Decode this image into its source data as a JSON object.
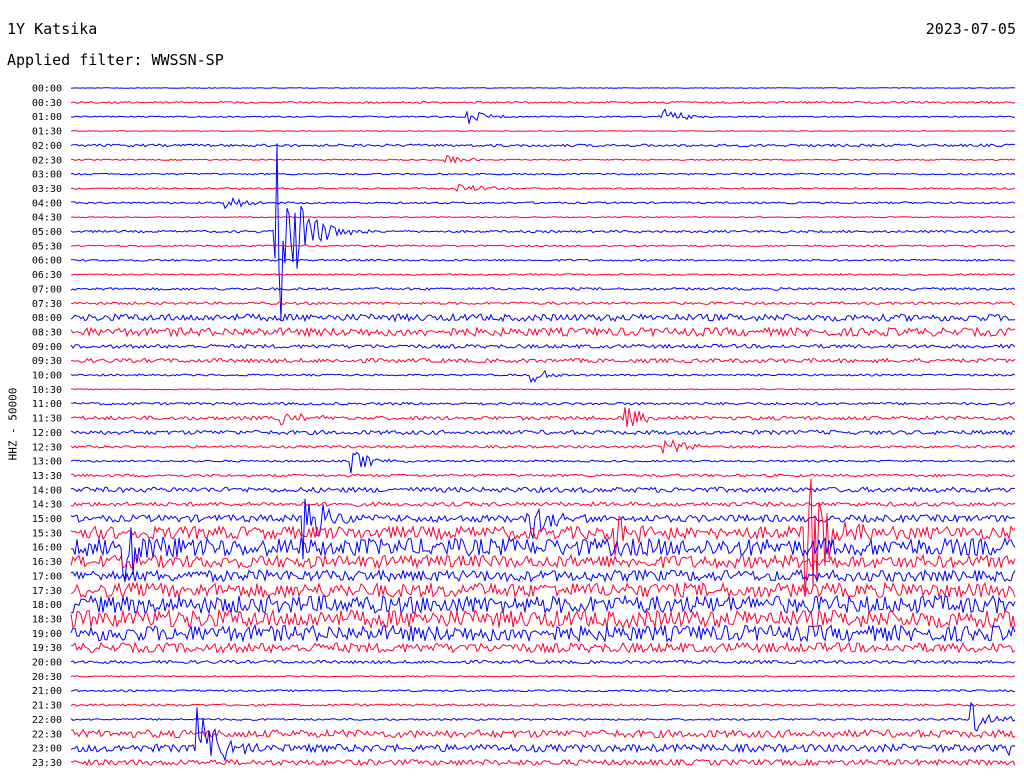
{
  "header": {
    "station": "1Y Katsika",
    "date": "2023-07-05",
    "filter": "Applied filter: WWSSN-SP"
  },
  "chart_data": {
    "type": "line",
    "title": "1Y Katsika",
    "ylabel": "HHZ - 50000",
    "row_labels": [
      "00:00",
      "00:30",
      "01:00",
      "01:30",
      "02:00",
      "02:30",
      "03:00",
      "03:30",
      "04:00",
      "04:30",
      "05:00",
      "05:30",
      "06:00",
      "06:30",
      "07:00",
      "07:30",
      "08:00",
      "08:30",
      "09:00",
      "09:30",
      "10:00",
      "10:30",
      "11:00",
      "11:30",
      "12:00",
      "12:30",
      "13:00",
      "13:30",
      "14:00",
      "14:30",
      "15:00",
      "15:30",
      "16:00",
      "16:30",
      "17:00",
      "17:30",
      "18:00",
      "18:30",
      "19:00",
      "19:30",
      "20:00",
      "20:30",
      "21:00",
      "21:30",
      "22:00",
      "22:30",
      "23:00",
      "23:30"
    ],
    "colors": [
      "#0000ff",
      "#ff0033"
    ],
    "row_noise": [
      0.2,
      0.6,
      0.4,
      0.2,
      0.8,
      0.4,
      0.5,
      0.5,
      0.6,
      0.3,
      0.7,
      0.5,
      0.6,
      0.5,
      0.8,
      0.8,
      2.2,
      2.6,
      1.2,
      1.3,
      0.6,
      0.3,
      0.8,
      1.2,
      1.3,
      0.8,
      0.6,
      0.8,
      1.6,
      1.3,
      2.2,
      4.0,
      5.5,
      4.0,
      3.5,
      4.5,
      5.5,
      5.5,
      5.0,
      3.0,
      1.0,
      0.4,
      0.6,
      0.7,
      0.6,
      2.4,
      2.4,
      1.8
    ],
    "events": [
      {
        "row": 2,
        "minute": 12.6,
        "amp": 8
      },
      {
        "row": 2,
        "minute": 18.7,
        "amp": 10
      },
      {
        "row": 5,
        "minute": 11.9,
        "amp": 5
      },
      {
        "row": 7,
        "minute": 12.2,
        "amp": 8
      },
      {
        "row": 8,
        "minute": 4.9,
        "amp": 9
      },
      {
        "row": 10,
        "minute": 6.5,
        "amp": 120
      },
      {
        "row": 20,
        "minute": 14.6,
        "amp": 8
      },
      {
        "row": 23,
        "minute": 6.7,
        "amp": 10
      },
      {
        "row": 23,
        "minute": 17.6,
        "amp": 12
      },
      {
        "row": 25,
        "minute": 18.8,
        "amp": 12
      },
      {
        "row": 26,
        "minute": 8.9,
        "amp": 12
      },
      {
        "row": 30,
        "minute": 7.4,
        "amp": 38
      },
      {
        "row": 30,
        "minute": 14.5,
        "amp": 30
      },
      {
        "row": 31,
        "minute": 17.2,
        "amp": 25
      },
      {
        "row": 31,
        "minute": 23.3,
        "amp": 80
      },
      {
        "row": 32,
        "minute": 1.7,
        "amp": 35
      },
      {
        "row": 46,
        "minute": 4.0,
        "amp": 45
      },
      {
        "row": 44,
        "minute": 28.6,
        "amp": 16
      },
      {
        "row": 46,
        "minute": 29.8,
        "amp": 10
      }
    ]
  }
}
